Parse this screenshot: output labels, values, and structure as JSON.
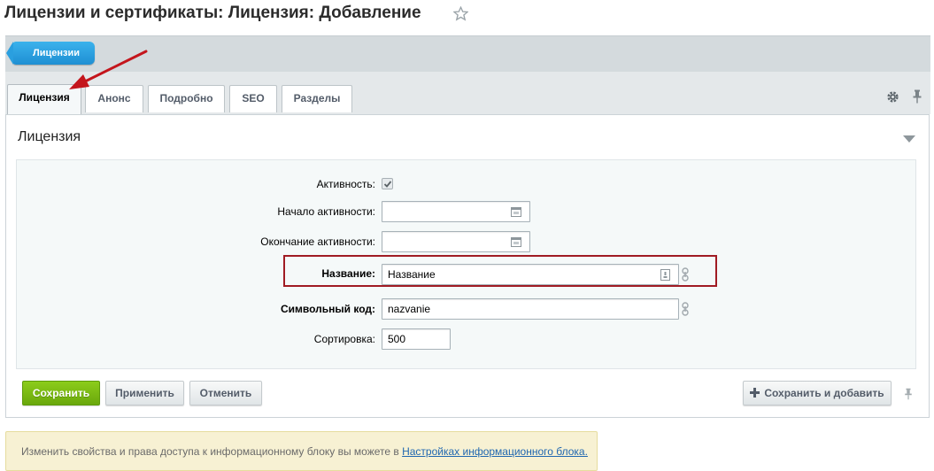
{
  "title": "Лицензии и сертификаты: Лицензия: Добавление",
  "breadcrumb": {
    "label": "Лицензии"
  },
  "tabs": [
    {
      "label": "Лицензия",
      "active": true
    },
    {
      "label": "Анонс"
    },
    {
      "label": "Подробно"
    },
    {
      "label": "SEO"
    },
    {
      "label": "Разделы"
    }
  ],
  "section": {
    "title": "Лицензия"
  },
  "form": {
    "active_label": "Активность:",
    "active_checked": true,
    "start_label": "Начало активности:",
    "start_value": "",
    "end_label": "Окончание активности:",
    "end_value": "",
    "name_label": "Название:",
    "name_value": "Название",
    "code_label": "Символьный код:",
    "code_value": "nazvanie",
    "sort_label": "Сортировка:",
    "sort_value": "500"
  },
  "buttons": {
    "save": "Сохранить",
    "apply": "Применить",
    "cancel": "Отменить",
    "save_add": "Сохранить и добавить"
  },
  "notice": {
    "text": "Изменить свойства и права доступа к информационному блоку вы можете в ",
    "link": "Настройках информационного блока."
  },
  "colors": {
    "accent_blue": "#1e8fd3",
    "save_green": "#6aa80c",
    "highlight_red": "#a01b23"
  },
  "icons": [
    "star-icon",
    "gear-icon",
    "pin-icon",
    "collapse-icon",
    "calendar-icon",
    "link-icon",
    "plus-icon",
    "arrow-annotation"
  ]
}
